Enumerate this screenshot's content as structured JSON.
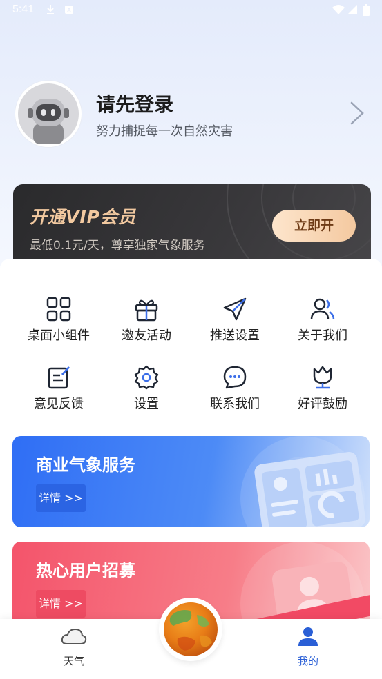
{
  "status_bar": {
    "time": "5:41"
  },
  "profile": {
    "title": "请先登录",
    "subtitle": "努力捕捉每一次自然灾害"
  },
  "vip": {
    "title": "开通VIP会员",
    "subtitle": "最低0.1元/天，尊享独家气象服务",
    "button": "立即开"
  },
  "grid": [
    {
      "label": "桌面小组件",
      "icon": "widgets-icon"
    },
    {
      "label": "邀友活动",
      "icon": "gift-icon"
    },
    {
      "label": "推送设置",
      "icon": "send-icon"
    },
    {
      "label": "关于我们",
      "icon": "users-icon"
    },
    {
      "label": "意见反馈",
      "icon": "feedback-icon"
    },
    {
      "label": "设置",
      "icon": "gear-icon"
    },
    {
      "label": "联系我们",
      "icon": "chat-icon"
    },
    {
      "label": "好评鼓励",
      "icon": "tulip-icon"
    }
  ],
  "banners": [
    {
      "title": "商业气象服务",
      "button": "详情 >>"
    },
    {
      "title": "热心用户招募",
      "button": "详情 >>"
    }
  ],
  "bottom_nav": {
    "weather": "天气",
    "mine": "我的"
  },
  "colors": {
    "accent": "#2a5fd6",
    "vip_gold": "#f2c9a0",
    "banner_blue": "#2f6ef5",
    "banner_red": "#f4546b"
  }
}
